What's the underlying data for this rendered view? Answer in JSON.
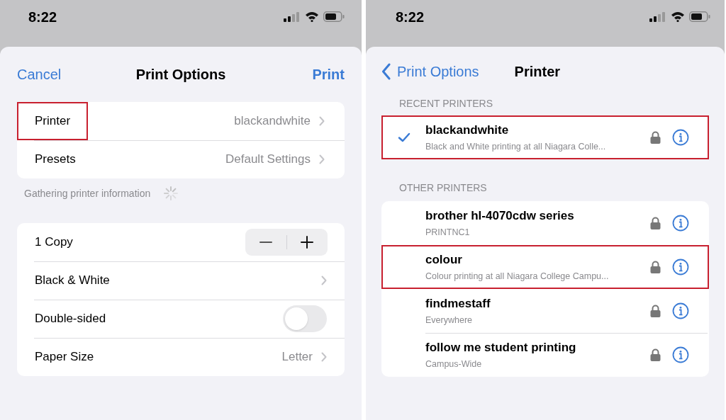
{
  "print_options": {
    "status_bar": {
      "time": "8:22"
    },
    "nav": {
      "cancel": "Cancel",
      "title": "Print Options",
      "action": "Print"
    },
    "printer_group": [
      {
        "label": "Printer",
        "value": "blackandwhite",
        "highlighted": true
      },
      {
        "label": "Presets",
        "value": "Default Settings",
        "highlighted": false
      }
    ],
    "status_note": "Gathering printer information",
    "settings": [
      {
        "kind": "stepper",
        "label": "1 Copy"
      },
      {
        "kind": "link",
        "label": "Black & White"
      },
      {
        "kind": "toggle",
        "label": "Double-sided",
        "on": false
      },
      {
        "kind": "link",
        "label": "Paper Size",
        "value": "Letter"
      }
    ]
  },
  "printer_picker": {
    "status_bar": {
      "time": "8:22"
    },
    "nav": {
      "back": "Print Options",
      "title": "Printer"
    },
    "sections": [
      {
        "header": "RECENT PRINTERS",
        "printers": [
          {
            "name": "blackandwhite",
            "detail": "Black and White printing at all Niagara Colle...",
            "selected": true,
            "highlighted": true
          }
        ]
      },
      {
        "header": "OTHER PRINTERS",
        "printers": [
          {
            "name": "brother hl-4070cdw series",
            "detail": "PRINTNC1",
            "selected": false,
            "highlighted": false
          },
          {
            "name": "colour",
            "detail": "Colour printing at all Niagara College Campu...",
            "selected": false,
            "highlighted": true
          },
          {
            "name": "findmestaff",
            "detail": "Everywhere",
            "selected": false,
            "highlighted": false
          },
          {
            "name": "follow me student printing",
            "detail": "Campus-Wide",
            "selected": false,
            "highlighted": false
          }
        ]
      }
    ]
  }
}
